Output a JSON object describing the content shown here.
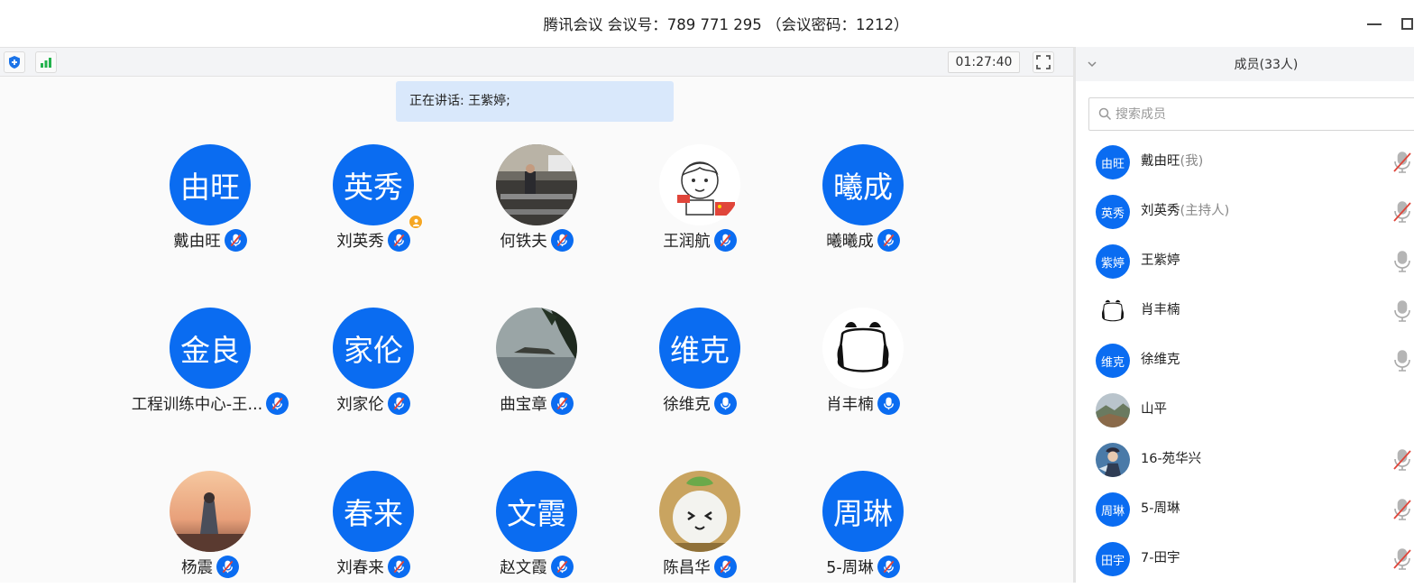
{
  "window": {
    "title": "腾讯会议 会议号：789 771 295 （会议密码：1212）"
  },
  "toolbar": {
    "timer": "01:27:40"
  },
  "stage": {
    "speaking_label": "正在讲话: 王紫婷;",
    "tiles": [
      {
        "name": "戴由旺",
        "avatar_text": "由旺",
        "mic": "muted"
      },
      {
        "name": "刘英秀",
        "avatar_text": "英秀",
        "mic": "muted",
        "host": true
      },
      {
        "name": "何铁夫",
        "avatar_text": "",
        "avatar_image": "classroom-photo",
        "mic": "muted"
      },
      {
        "name": "王润航",
        "avatar_text": "",
        "avatar_image": "cartoon-boy-with-flag",
        "mic": "muted"
      },
      {
        "name": "曦曦成",
        "avatar_text": "曦成",
        "mic": "muted"
      },
      {
        "name": "工程训练中心-王...",
        "avatar_text": "金良",
        "mic": "muted"
      },
      {
        "name": "刘家伦",
        "avatar_text": "家伦",
        "mic": "muted"
      },
      {
        "name": "曲宝章",
        "avatar_text": "",
        "avatar_image": "lake-island-photo",
        "mic": "muted"
      },
      {
        "name": "徐维克",
        "avatar_text": "维克",
        "mic": "on"
      },
      {
        "name": "肖丰楠",
        "avatar_text": "",
        "avatar_image": "panda-sketch",
        "mic": "on"
      },
      {
        "name": "杨震",
        "avatar_text": "",
        "avatar_image": "sunset-person-photo",
        "mic": "muted"
      },
      {
        "name": "刘春来",
        "avatar_text": "春来",
        "mic": "muted"
      },
      {
        "name": "赵文霞",
        "avatar_text": "文霞",
        "mic": "muted"
      },
      {
        "name": "陈昌华",
        "avatar_text": "",
        "avatar_image": "cute-toy-photo",
        "mic": "muted"
      },
      {
        "name": "5-周琳",
        "avatar_text": "周琳",
        "mic": "muted"
      }
    ]
  },
  "members": {
    "title": "成员(33人)",
    "search_placeholder": "搜索成员",
    "list": [
      {
        "name": "戴由旺",
        "tag": "(我)",
        "avatar_text": "由旺",
        "mic": "muted"
      },
      {
        "name": "刘英秀",
        "tag": "(主持人)",
        "avatar_text": "英秀",
        "mic": "muted"
      },
      {
        "name": "王紫婷",
        "tag": "",
        "avatar_text": "紫婷",
        "mic": "on"
      },
      {
        "name": "肖丰楠",
        "tag": "",
        "avatar_text": "",
        "avatar_image": "panda-sketch",
        "mic": "on"
      },
      {
        "name": "徐维克",
        "tag": "",
        "avatar_text": "维克",
        "mic": "on"
      },
      {
        "name": "山平",
        "tag": "",
        "avatar_text": "",
        "avatar_image": "landscape-photo",
        "mic": "none"
      },
      {
        "name": "16-苑华兴",
        "tag": "",
        "avatar_text": "",
        "avatar_image": "anime-photo",
        "mic": "muted"
      },
      {
        "name": "5-周琳",
        "tag": "",
        "avatar_text": "周琳",
        "mic": "muted"
      },
      {
        "name": "7-田宇",
        "tag": "",
        "avatar_text": "田宇",
        "mic": "muted"
      }
    ]
  },
  "colors": {
    "accent": "#0a6cf1",
    "banner": "#d9e8fb",
    "muted_red": "#e0453a",
    "host_badge": "#f5a623",
    "signal_green": "#22b24c"
  }
}
